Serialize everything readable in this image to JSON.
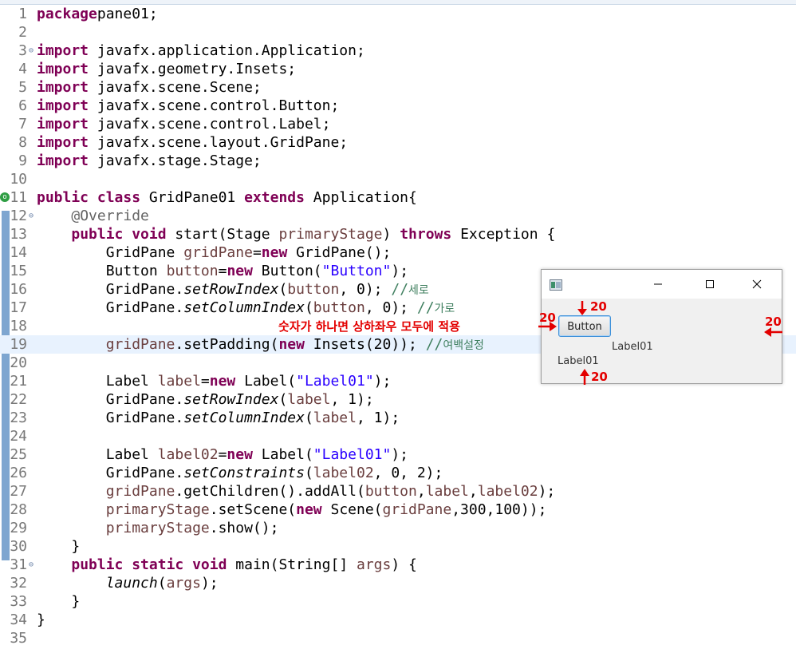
{
  "editor": {
    "lines": [
      {
        "n": "1",
        "tokens": [
          [
            "kw",
            "package"
          ],
          [
            "",
            "pane01;"
          ]
        ]
      },
      {
        "n": "2",
        "tokens": []
      },
      {
        "n": "3",
        "fold": "⊖",
        "tokens": [
          [
            "kw",
            "import"
          ],
          [
            "",
            " javafx.application.Application;"
          ]
        ]
      },
      {
        "n": "4",
        "tokens": [
          [
            "kw",
            "import"
          ],
          [
            "",
            " javafx.geometry.Insets;"
          ]
        ]
      },
      {
        "n": "5",
        "tokens": [
          [
            "kw",
            "import"
          ],
          [
            "",
            " javafx.scene.Scene;"
          ]
        ]
      },
      {
        "n": "6",
        "tokens": [
          [
            "kw",
            "import"
          ],
          [
            "",
            " javafx.scene.control.Button;"
          ]
        ]
      },
      {
        "n": "7",
        "tokens": [
          [
            "kw",
            "import"
          ],
          [
            "",
            " javafx.scene.control.Label;"
          ]
        ]
      },
      {
        "n": "8",
        "tokens": [
          [
            "kw",
            "import"
          ],
          [
            "",
            " javafx.scene.layout.GridPane;"
          ]
        ]
      },
      {
        "n": "9",
        "tokens": [
          [
            "kw",
            "import"
          ],
          [
            "",
            " javafx.stage.Stage;"
          ]
        ]
      },
      {
        "n": "10",
        "tokens": []
      },
      {
        "n": "11",
        "marker": true,
        "tokens": [
          [
            "kw",
            "public class"
          ],
          [
            "",
            " GridPane01 "
          ],
          [
            "kw",
            "extends"
          ],
          [
            "",
            " Application{"
          ]
        ]
      },
      {
        "n": "12",
        "fold": "⊖",
        "tokens": [
          [
            "",
            "    "
          ],
          [
            "ann",
            "@Override"
          ]
        ]
      },
      {
        "n": "13",
        "tokens": [
          [
            "",
            "    "
          ],
          [
            "kw",
            "public void"
          ],
          [
            "",
            " start(Stage "
          ],
          [
            "var",
            "primaryStage"
          ],
          [
            "",
            ") "
          ],
          [
            "kw",
            "throws"
          ],
          [
            "",
            " Exception {"
          ]
        ]
      },
      {
        "n": "14",
        "tokens": [
          [
            "",
            "        GridPane "
          ],
          [
            "var",
            "gridPane"
          ],
          [
            "",
            "="
          ],
          [
            "kw",
            "new"
          ],
          [
            "",
            " GridPane();"
          ]
        ]
      },
      {
        "n": "15",
        "tokens": [
          [
            "",
            "        Button "
          ],
          [
            "var",
            "button"
          ],
          [
            "",
            "="
          ],
          [
            "kw",
            "new"
          ],
          [
            "",
            " Button("
          ],
          [
            "str",
            "\"Button\""
          ],
          [
            "",
            ");"
          ]
        ]
      },
      {
        "n": "16",
        "tokens": [
          [
            "",
            "        GridPane."
          ],
          [
            "it",
            "setRowIndex"
          ],
          [
            "",
            "("
          ],
          [
            "var",
            "button"
          ],
          [
            "",
            ", 0); "
          ],
          [
            "cmt",
            "//"
          ],
          [
            "cmtk",
            "세로"
          ]
        ]
      },
      {
        "n": "17",
        "tokens": [
          [
            "",
            "        GridPane."
          ],
          [
            "it",
            "setColumnIndex"
          ],
          [
            "",
            "("
          ],
          [
            "var",
            "button"
          ],
          [
            "",
            ", 0); "
          ],
          [
            "cmt",
            "//"
          ],
          [
            "cmtk",
            "가로"
          ]
        ]
      },
      {
        "n": "18",
        "tokens": []
      },
      {
        "n": "19",
        "current": true,
        "tokens": [
          [
            "",
            "        "
          ],
          [
            "var",
            "gridPane"
          ],
          [
            "",
            ".setPadding("
          ],
          [
            "kw",
            "new"
          ],
          [
            "",
            " Insets(20)); "
          ],
          [
            "cmt",
            "//"
          ],
          [
            "cmtk",
            "여백설정"
          ]
        ]
      },
      {
        "n": "20",
        "tokens": []
      },
      {
        "n": "21",
        "tokens": [
          [
            "",
            "        Label "
          ],
          [
            "var",
            "label"
          ],
          [
            "",
            "="
          ],
          [
            "kw",
            "new"
          ],
          [
            "",
            " Label("
          ],
          [
            "str",
            "\"Label01\""
          ],
          [
            "",
            ");"
          ]
        ]
      },
      {
        "n": "22",
        "tokens": [
          [
            "",
            "        GridPane."
          ],
          [
            "it",
            "setRowIndex"
          ],
          [
            "",
            "("
          ],
          [
            "var",
            "label"
          ],
          [
            "",
            ", 1);"
          ]
        ]
      },
      {
        "n": "23",
        "tokens": [
          [
            "",
            "        GridPane."
          ],
          [
            "it",
            "setColumnIndex"
          ],
          [
            "",
            "("
          ],
          [
            "var",
            "label"
          ],
          [
            "",
            ", 1);"
          ]
        ]
      },
      {
        "n": "24",
        "tokens": []
      },
      {
        "n": "25",
        "tokens": [
          [
            "",
            "        Label "
          ],
          [
            "var",
            "label02"
          ],
          [
            "",
            "="
          ],
          [
            "kw",
            "new"
          ],
          [
            "",
            " Label("
          ],
          [
            "str",
            "\"Label01\""
          ],
          [
            "",
            ");"
          ]
        ]
      },
      {
        "n": "26",
        "tokens": [
          [
            "",
            "        GridPane."
          ],
          [
            "it",
            "setConstraints"
          ],
          [
            "",
            "("
          ],
          [
            "var",
            "label02"
          ],
          [
            "",
            ", 0, 2);"
          ]
        ]
      },
      {
        "n": "27",
        "tokens": [
          [
            "",
            "        "
          ],
          [
            "var",
            "gridPane"
          ],
          [
            "",
            ".getChildren().addAll("
          ],
          [
            "var",
            "button"
          ],
          [
            "",
            ","
          ],
          [
            "var",
            "label"
          ],
          [
            "",
            ","
          ],
          [
            "var",
            "label02"
          ],
          [
            "",
            ");"
          ]
        ]
      },
      {
        "n": "28",
        "tokens": [
          [
            "",
            "        "
          ],
          [
            "var",
            "primaryStage"
          ],
          [
            "",
            ".setScene("
          ],
          [
            "kw",
            "new"
          ],
          [
            "",
            " Scene("
          ],
          [
            "var",
            "gridPane"
          ],
          [
            "",
            ",300,100));"
          ]
        ]
      },
      {
        "n": "29",
        "tokens": [
          [
            "",
            "        "
          ],
          [
            "var",
            "primaryStage"
          ],
          [
            "",
            ".show();"
          ]
        ]
      },
      {
        "n": "30",
        "tokens": [
          [
            "",
            "    }"
          ]
        ]
      },
      {
        "n": "31",
        "fold": "⊖",
        "tokens": [
          [
            "",
            "    "
          ],
          [
            "kw",
            "public static void"
          ],
          [
            "",
            " main(String[] "
          ],
          [
            "var",
            "args"
          ],
          [
            "",
            ") {"
          ]
        ]
      },
      {
        "n": "32",
        "tokens": [
          [
            "",
            "        "
          ],
          [
            "it",
            "launch"
          ],
          [
            "",
            "("
          ],
          [
            "var",
            "args"
          ],
          [
            "",
            ");"
          ]
        ]
      },
      {
        "n": "33",
        "tokens": [
          [
            "",
            "    }"
          ]
        ]
      },
      {
        "n": "34",
        "tokens": [
          [
            "",
            "}"
          ]
        ]
      },
      {
        "n": "35",
        "tokens": []
      }
    ]
  },
  "annotation": {
    "text": "숫자가 하나면 상하좌우 모두에 적용",
    "color": "#e30000"
  },
  "preview_window": {
    "icon": "javafx-app-icon",
    "controls": {
      "minimize": "minimize-icon",
      "maximize": "maximize-icon",
      "close": "close-icon"
    },
    "button_label": "Button",
    "label1": "Label01",
    "label2": "Label01",
    "padding_labels": {
      "top": "20",
      "left": "20",
      "right": "20",
      "bottom": "20"
    }
  }
}
